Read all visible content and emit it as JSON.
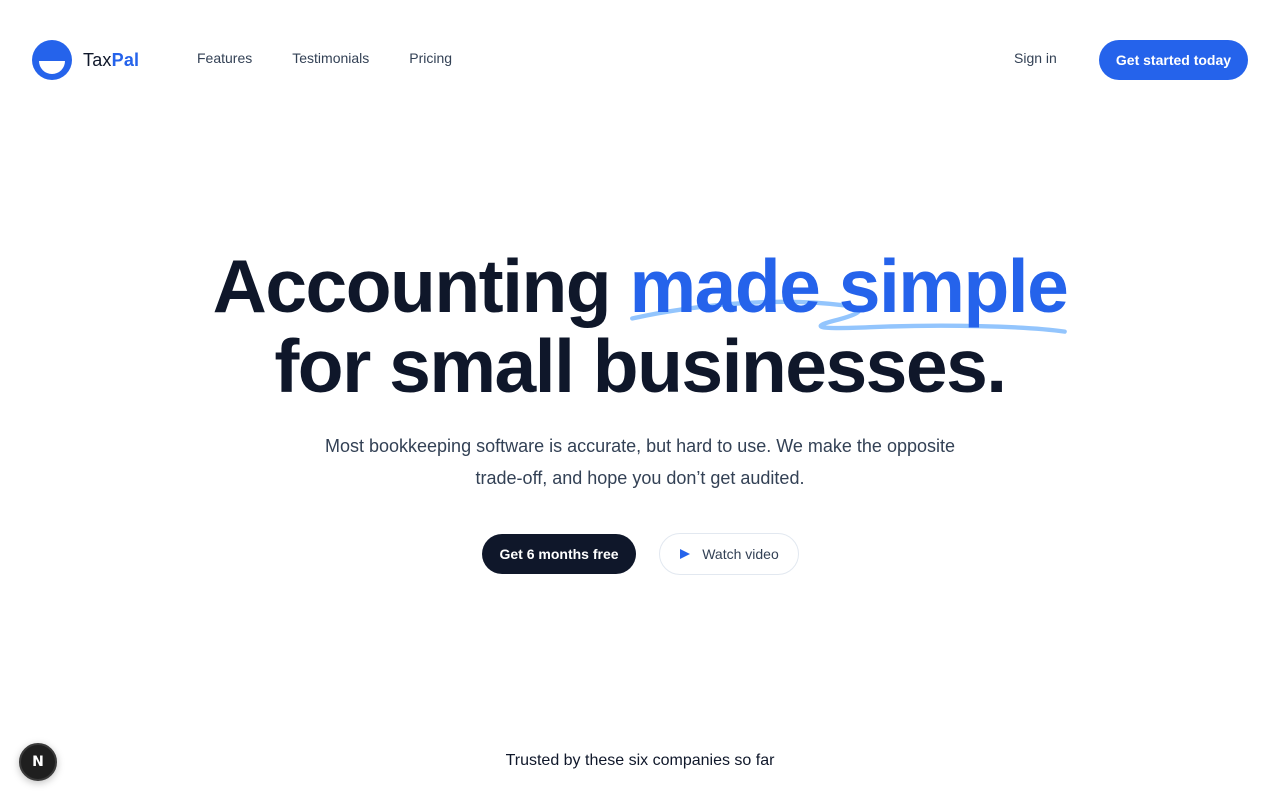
{
  "brand": {
    "name_part1": "Tax",
    "name_part2": "Pal",
    "accent": "#2563eb",
    "dark": "#0f172a"
  },
  "nav": {
    "items": [
      {
        "label": "Features"
      },
      {
        "label": "Testimonials"
      },
      {
        "label": "Pricing"
      }
    ]
  },
  "header": {
    "signin_label": "Sign in",
    "cta_label": "Get started today"
  },
  "hero": {
    "title_prefix": "Accounting",
    "title_accent": "made simple",
    "title_line2": "for small businesses.",
    "subtitle": "Most bookkeeping software is accurate, but hard to use. We make the opposite trade-off, and hope you don’t get audited.",
    "primary_button": "Get 6 months free",
    "secondary_button": "Watch video",
    "secondary_icon": "play-icon"
  },
  "trusted": {
    "text": "Trusted by these six companies so far"
  },
  "dev_badge": {
    "letter": "N",
    "icon": "nextjs-icon"
  }
}
